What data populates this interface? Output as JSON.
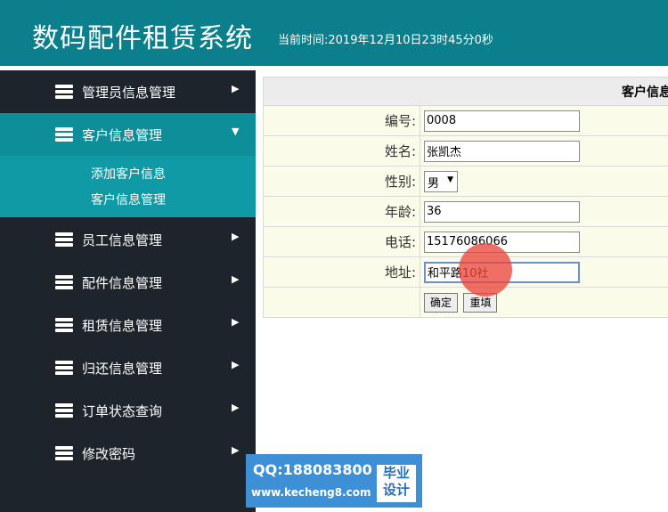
{
  "header": {
    "title": "数码配件租赁系统",
    "time_text": "当前时间:2019年12月10日23时45分0秒"
  },
  "sidebar": {
    "items": [
      {
        "label": "管理员信息管理",
        "arrow": "▶"
      },
      {
        "label": "客户信息管理",
        "arrow": "▼"
      },
      {
        "label": "员工信息管理",
        "arrow": "▶"
      },
      {
        "label": "配件信息管理",
        "arrow": "▶"
      },
      {
        "label": "租赁信息管理",
        "arrow": "▶"
      },
      {
        "label": "归还信息管理",
        "arrow": "▶"
      },
      {
        "label": "订单状态查询",
        "arrow": "▶"
      },
      {
        "label": "修改密码",
        "arrow": "▶"
      }
    ],
    "submenu": [
      {
        "label": "添加客户信息"
      },
      {
        "label": "客户信息管理"
      }
    ]
  },
  "form": {
    "caption": "客户信息",
    "fields": {
      "id_label": "编号:",
      "id_value": "0008",
      "name_label": "姓名:",
      "name_value": "张凯杰",
      "gender_label": "性别:",
      "gender_value": "男",
      "age_label": "年龄:",
      "age_value": "36",
      "phone_label": "电话:",
      "phone_value": "15176086066",
      "address_label": "地址:",
      "address_value": "和平路10社"
    },
    "confirm_label": "确定",
    "reset_label": "重填"
  },
  "watermark": {
    "qq": "QQ:188083800",
    "site": "www.kecheng8.com",
    "tag_line1": "毕业",
    "tag_line2": "设计"
  }
}
